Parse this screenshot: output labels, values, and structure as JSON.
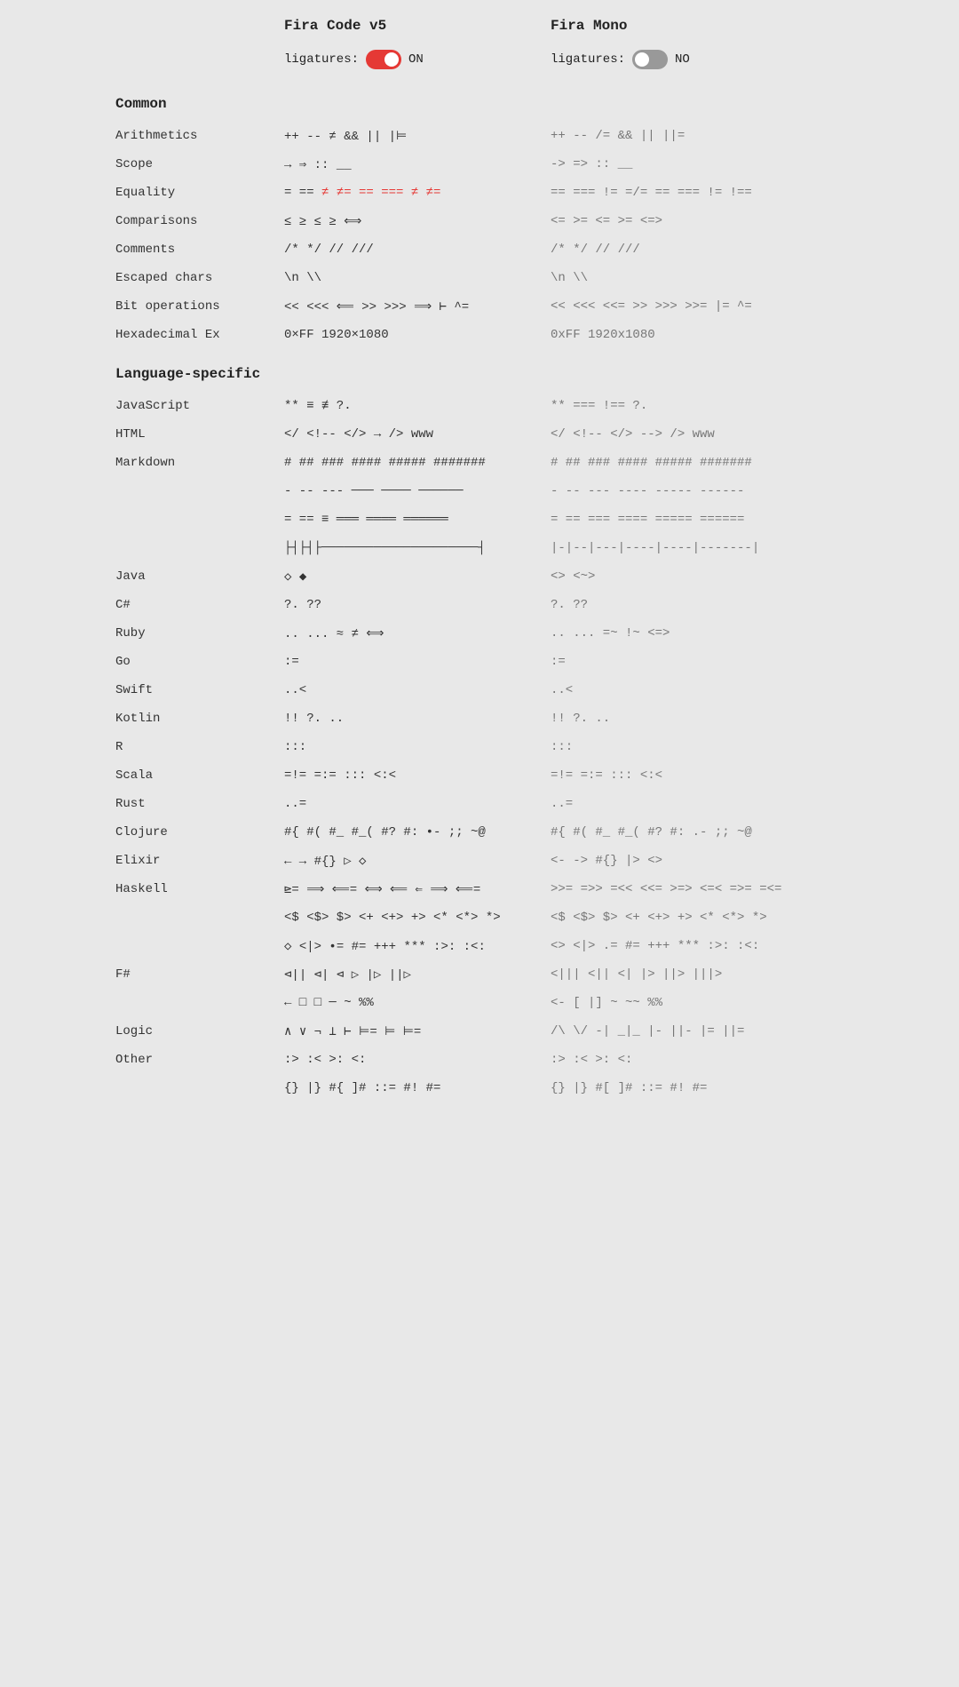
{
  "header": {
    "fira_code_title": "Fira Code v5",
    "fira_mono_title": "Fira Mono",
    "ligatures_on_label": "ligatures:",
    "ligatures_on_value": "ON",
    "ligatures_no_label": "ligatures:",
    "ligatures_no_value": "NO"
  },
  "sections": [
    {
      "name": "Common",
      "is_header": true
    },
    {
      "label": "Arithmetics",
      "fira_code": "++ -- ≠ && || |⊨",
      "fira_mono": "++ -- /= && || ||="
    },
    {
      "label": "Scope",
      "fira_code": "→ ⇒ :: __",
      "fira_mono": "-> => :: __"
    },
    {
      "label": "Equality",
      "fira_code": "= == ≠ ≠= == === ≠ ≠=",
      "fira_mono": "== === != =/= == === != !==",
      "red_fira_code": "== === ≠ ≠="
    },
    {
      "label": "Comparisons",
      "fira_code": "≤ ≥ ≤ ≥ ⟺",
      "fira_mono": "<= >= <= >= <=>"
    },
    {
      "label": "Comments",
      "fira_code": "/* */ // ///",
      "fira_mono": "/* */ // ///"
    },
    {
      "label": "Escaped chars",
      "fira_code": "\\n \\\\",
      "fira_mono": "\\n \\\\"
    },
    {
      "label": "Bit operations",
      "fira_code": "<< <<< ⟸ >> >>> ⟹ ⊢ ^=",
      "fira_mono": "<< <<< <<= >> >>> >>= |= ^="
    },
    {
      "label": "Hexadecimal Ex",
      "fira_code": "0×FF 1920×1080",
      "fira_mono": "0xFF 1920x1080"
    },
    {
      "name": "Language-specific",
      "is_header": true
    },
    {
      "label": "JavaScript",
      "fira_code": "** ≡ ≢ ?.",
      "fira_mono": "** === !== ?."
    },
    {
      "label": "HTML",
      "fira_code": "</ <!--  </> → /> www",
      "fira_mono": "</ <!-- </>  --> /> www"
    },
    {
      "label": "Markdown",
      "fira_code": "# ## ### #### ##### #######",
      "fira_mono": "# ## ### #### ##### #######"
    },
    {
      "label": "",
      "fira_code": "- -- --- ─── ──── ──────",
      "fira_mono": "- -- --- ---- ----- ------"
    },
    {
      "label": "",
      "fira_code": "= == ≡ ═══ ════ ══════",
      "fira_mono": "= == === ==== ===== ======"
    },
    {
      "label": "",
      "fira_code": "├┤├┤├─────────────────────┤",
      "fira_mono": "|-|--|---|----|----|-------|"
    },
    {
      "label": "Java",
      "fira_code": "◇ ◆",
      "fira_mono": "<> <~>"
    },
    {
      "label": "C#",
      "fira_code": "?. ??",
      "fira_mono": "?. ??"
    },
    {
      "label": "Ruby",
      "fira_code": ".. ... ≈ ≠ ⟺",
      "fira_mono": ".. ... =~ !~ <=>"
    },
    {
      "label": "Go",
      "fira_code": ":=",
      "fira_mono": ":="
    },
    {
      "label": "Swift",
      "fira_code": "..<",
      "fira_mono": "..<"
    },
    {
      "label": "Kotlin",
      "fira_code": "!! ?.  ..",
      "fira_mono": "!! ?.  .."
    },
    {
      "label": "R",
      "fira_code": ":::",
      "fira_mono": ":::"
    },
    {
      "label": "Scala",
      "fira_code": "=!= =:= ::: <:<",
      "fira_mono": "=!= =:= ::: <:<"
    },
    {
      "label": "Rust",
      "fira_code": "..=",
      "fira_mono": "..="
    },
    {
      "label": "Clojure",
      "fira_code": "#{ #( #_ #_( #? #: •- ;; ~@",
      "fira_mono": "#{ #( #_ #_( #? #:  .- ;; ~@"
    },
    {
      "label": "Elixir",
      "fira_code": "← → #{} ▷ ◇",
      "fira_mono": "<- -> #{} |> <>"
    },
    {
      "label": "Haskell",
      "fira_code": "⊵= ⟹ ⟸= ⟺ ⟸ ⇐ ⟹ ⟸=",
      "fira_mono": ">>= =>> =<< <<= >=> <=< =>= =<="
    },
    {
      "label": "",
      "fira_code": "<$ <$> $> <+ <+> +> <* <*> *>",
      "fira_mono": "<$ <$> $> <+ <+> +> <* <*> *>"
    },
    {
      "label": "",
      "fira_code": "◇ <|> •= #= +++ *** :>: :<:",
      "fira_mono": "<> <|> .= #= +++ *** :>: :<:"
    },
    {
      "label": "F#",
      "fira_code": "⊲|| ⊲| ⊲ ▷ |▷ ||▷",
      "fira_mono": "<||| <|| <| |> ||> |||>"
    },
    {
      "label": "",
      "fira_code": "← □ □ ─ ~ %%",
      "fira_mono": "<- [ |] ~ ~~ %%"
    },
    {
      "label": "Logic",
      "fira_code": "∧ ∨ ¬ ⊥ ⊢ ⊨= ⊨ ⊨=",
      "fira_mono": "/\\ \\/ -| _|_ |- ||- |= ||="
    },
    {
      "label": "Other",
      "fira_code": ":> :< >: <:",
      "fira_mono": ":> :< >: <:"
    },
    {
      "label": "",
      "fira_code": "{} |} #{ ]# ::= #! #=",
      "fira_mono": "{} |} #[ ]# ::= #! #="
    }
  ]
}
